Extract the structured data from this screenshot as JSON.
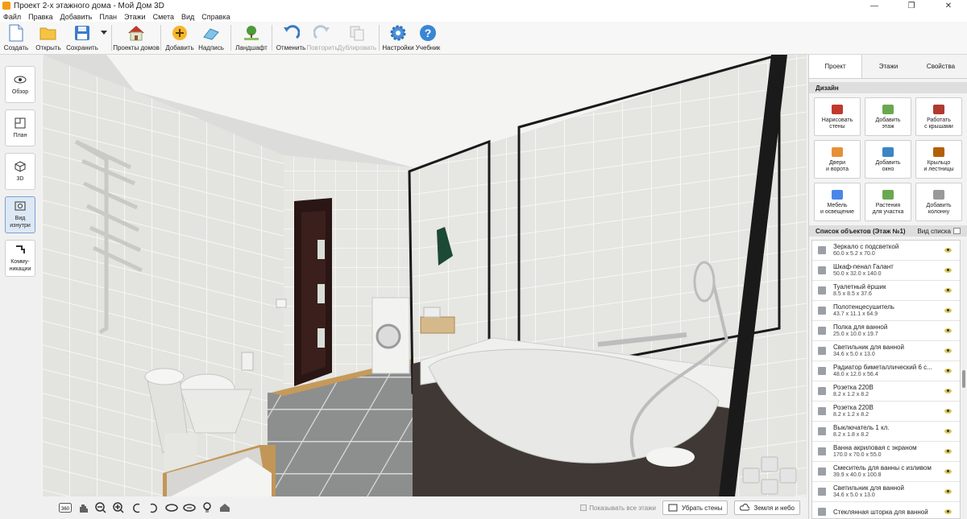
{
  "window": {
    "title": "Проект 2-х этажного дома - Мой Дом 3D",
    "controls": [
      "—",
      "❐",
      "✕"
    ]
  },
  "menu": [
    "Файл",
    "Правка",
    "Добавить",
    "План",
    "Этажи",
    "Смета",
    "Вид",
    "Справка"
  ],
  "toolbar": {
    "create": "Создать",
    "open": "Открыть",
    "save": "Сохранить",
    "projects": "Проекты домов",
    "add": "Добавить",
    "label": "Надпись",
    "landscape": "Ландшафт",
    "undo": "Отменить",
    "redo": "Повторить",
    "duplicate": "Дублировать",
    "settings": "Настройки",
    "tutorial": "Учебник"
  },
  "left_panel": {
    "overview": "Обзор",
    "plan": "План",
    "view3d": "3D",
    "inside_1": "Вид",
    "inside_2": "изнутри",
    "comm_1": "Комму-",
    "comm_2": "никации"
  },
  "bottom_bar": {
    "rotate360": "360",
    "show_all_floors": "Показывать все этажи",
    "remove_walls": "Убрать стены",
    "ground_sky": "Земля и небо"
  },
  "right_panel": {
    "tabs": [
      "Проект",
      "Этажи",
      "Свойства"
    ],
    "design_header": "Дизайн",
    "design_buttons": [
      {
        "l1": "Нарисовать",
        "l2": "стены",
        "icon": "bricks-icon",
        "color": "#c0392b"
      },
      {
        "l1": "Добавить",
        "l2": "этаж",
        "icon": "floor-icon",
        "color": "#6aa84f"
      },
      {
        "l1": "Работать",
        "l2": "с крышами",
        "icon": "roof-icon",
        "color": "#b03a2e"
      },
      {
        "l1": "Двери",
        "l2": "и ворота",
        "icon": "door-icon",
        "color": "#e69138"
      },
      {
        "l1": "Добавить",
        "l2": "окно",
        "icon": "window-icon",
        "color": "#3d85c6"
      },
      {
        "l1": "Крыльцо",
        "l2": "и лестницы",
        "icon": "stairs-icon",
        "color": "#b45f06"
      },
      {
        "l1": "Мебель",
        "l2": "и освещение",
        "icon": "armchair-icon",
        "color": "#4a86e8"
      },
      {
        "l1": "Растения",
        "l2": "для участка",
        "icon": "plant-icon",
        "color": "#6aa84f"
      },
      {
        "l1": "Добавить",
        "l2": "колонну",
        "icon": "column-icon",
        "color": "#999999"
      }
    ],
    "list_header": "Список объектов (Этаж №1)",
    "view_list": "Вид списка",
    "objects": [
      {
        "name": "Зеркало с подсветкой",
        "dims": "60.0 x 5.2 x 70.0"
      },
      {
        "name": "Шкаф-пенал Галант",
        "dims": "50.0 x 32.0 x 140.0"
      },
      {
        "name": "Туалетный ёршик",
        "dims": "8.5 x 8.5 x 37.6"
      },
      {
        "name": "Полотенцесушитель",
        "dims": "43.7 x 11.1 x 64.9"
      },
      {
        "name": "Полка для ванной",
        "dims": "25.0 x 10.0 x 19.7"
      },
      {
        "name": "Светильник для ванной",
        "dims": "34.6 x 5.0 x 13.0"
      },
      {
        "name": "Радиатор биметаллический 6 с...",
        "dims": "48.0 x 12.0 x 56.4"
      },
      {
        "name": "Розетка 220В",
        "dims": "8.2 x 1.2 x 8.2"
      },
      {
        "name": "Розетка 220В",
        "dims": "8.2 x 1.2 x 8.2"
      },
      {
        "name": "Выключатель 1 кл.",
        "dims": "8.2 x 1.8 x 8.2"
      },
      {
        "name": "Ванна акриловая с экраном",
        "dims": "170.0 x 70.0 x 55.0"
      },
      {
        "name": "Смеситель для ванны с изливом",
        "dims": "39.9 x 40.0 x 100.8"
      },
      {
        "name": "Светильник для ванной",
        "dims": "34.6 x 5.0 x 13.0"
      },
      {
        "name": "Стеклянная шторка для ванной",
        "dims": ""
      }
    ]
  }
}
